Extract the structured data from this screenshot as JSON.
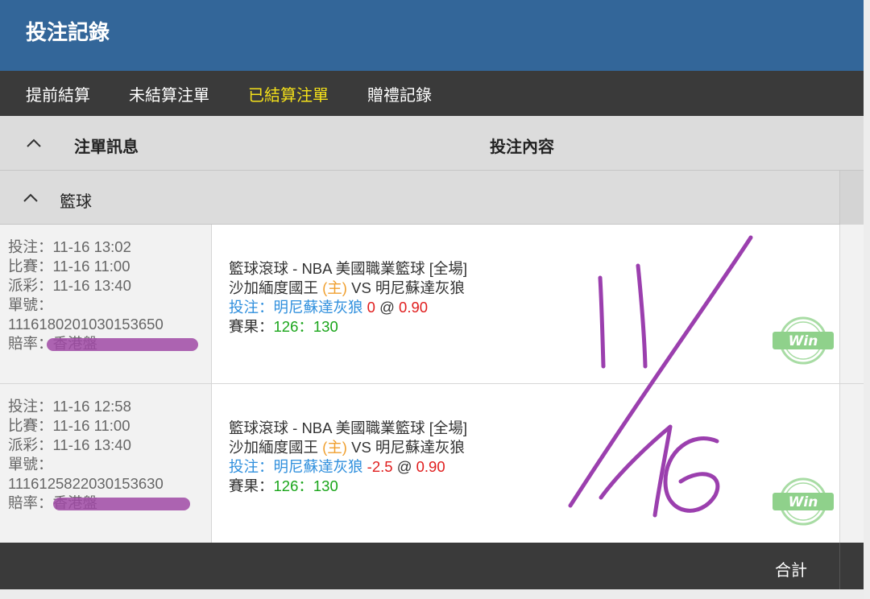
{
  "header": {
    "title": "投注記錄"
  },
  "tabs": [
    {
      "label": "提前結算",
      "active": false
    },
    {
      "label": "未結算注單",
      "active": false
    },
    {
      "label": "已結算注單",
      "active": true
    },
    {
      "label": "贈禮記錄",
      "active": false
    }
  ],
  "columns": {
    "info": "注單訊息",
    "content": "投注內容"
  },
  "sport": {
    "label": "籃球"
  },
  "bets": [
    {
      "placed": "投注：11-16 13:02",
      "match_time": "比賽：11-16 11:00",
      "payout_time": "派彩：11-16 13:40",
      "ticket_label": "單號：",
      "ticket_no": "1116180201030153650",
      "odds_type": "賠率：香港盤",
      "league": "籃球滾球 - NBA 美國職業籃球 [全場]",
      "home": "沙加緬度國王 ",
      "home_tag": "(主)",
      "vs": " VS 明尼蘇達灰狼",
      "bet_label": "投注：",
      "selection": "明尼蘇達灰狼",
      "handicap": " 0",
      "at": " @ ",
      "odds": "0.90",
      "result_label": "賽果：",
      "result": "126：130",
      "status": "Win"
    },
    {
      "placed": "投注：11-16 12:58",
      "match_time": "比賽：11-16 11:00",
      "payout_time": "派彩：11-16 13:40",
      "ticket_label": "單號：",
      "ticket_no": "1116125822030153630",
      "odds_type": "賠率：香港盤",
      "league": "籃球滾球 - NBA 美國職業籃球 [全場]",
      "home": "沙加緬度國王 ",
      "home_tag": "(主)",
      "vs": " VS 明尼蘇達灰狼",
      "bet_label": "投注：",
      "selection": "明尼蘇達灰狼",
      "handicap": " -2.5",
      "at": " @ ",
      "odds": "0.90",
      "result_label": "賽果：",
      "result": "126：130",
      "status": "Win"
    }
  ],
  "footer": {
    "total_label": "合計"
  },
  "colors": {
    "header_bg": "#336699",
    "tabbar_bg": "#3a3a3a",
    "tab_active": "#f5e11a",
    "win_green": "#8fd18b",
    "handwriting": "#9b3fae",
    "selection_blue": "#2f8fdd",
    "odds_red": "#e01e1e",
    "result_green": "#1aa51a",
    "home_tag_orange": "#f0a030"
  },
  "icons": {
    "collapse": "chevron-up-icon",
    "win": "win-badge-icon"
  }
}
